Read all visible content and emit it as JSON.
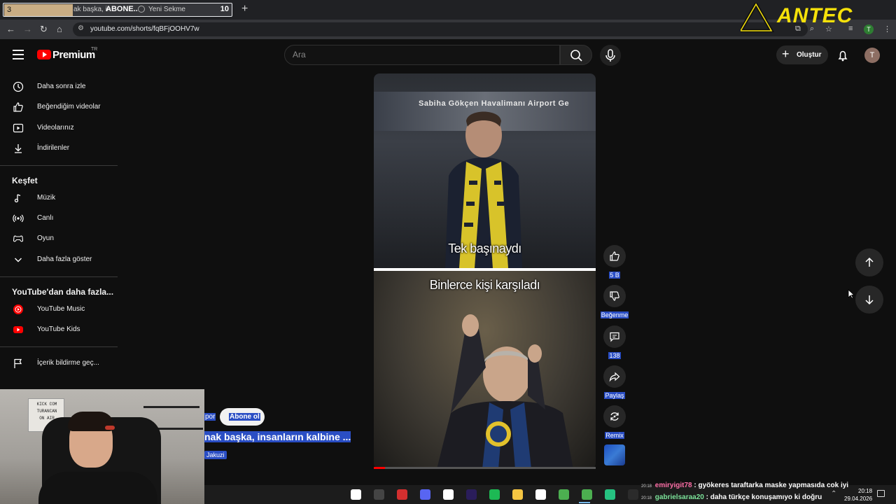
{
  "browser": {
    "tab_number_left": "3",
    "tab_partial_text": "ak başka, in",
    "tab_title": "ABONE..",
    "tab_newtab_label": "Yeni Sekme",
    "tab_count": "10",
    "url": "youtube.com/shorts/fqBFjOOHV7w"
  },
  "overlay_logo": {
    "text": "ANTEC"
  },
  "header": {
    "brand": "Premium",
    "country": "TR",
    "search_placeholder": "Ara",
    "create_label": "Oluştur",
    "avatar_letter": "T"
  },
  "sidebar": {
    "items_top": [
      {
        "label": "Daha sonra izle",
        "icon": "clock-icon"
      },
      {
        "label": "Beğendiğim videolar",
        "icon": "thumb-up-icon"
      },
      {
        "label": "Videolarınız",
        "icon": "play-box-icon"
      },
      {
        "label": "İndirilenler",
        "icon": "download-icon"
      }
    ],
    "explore_title": "Keşfet",
    "explore_items": [
      {
        "label": "Müzik",
        "icon": "music-note-icon"
      },
      {
        "label": "Canlı",
        "icon": "live-icon"
      },
      {
        "label": "Oyun",
        "icon": "gamepad-icon"
      },
      {
        "label": "Daha fazla göster",
        "icon": "chevron-down-icon"
      }
    ],
    "more_title": "YouTube'dan daha fazla...",
    "more_items": [
      {
        "label": "YouTube Music",
        "icon": "youtube-music-icon"
      },
      {
        "label": "YouTube Kids",
        "icon": "youtube-kids-icon"
      }
    ],
    "report_label": "İçerik bildirme geç..."
  },
  "short": {
    "sign_text": "Sabiha Gökçen Havalimanı Airport Ge",
    "caption_top": "Tek başınaydı",
    "caption_bottom": "Binlerce kişi karşıladı",
    "progress": 0.05
  },
  "actions": {
    "likes": "5 B",
    "dislike_label": "Beğenme",
    "comments": "138",
    "share_label": "Paylaş",
    "remix_label": "Remix"
  },
  "overlay_meta": {
    "channel_partial": "por",
    "subscribe_label": "Abone ol",
    "title_partial": "nak başka, insanların kalbine ...",
    "sound_name": "Jakuzi"
  },
  "webcam": {
    "sign_lines": [
      "KICK COM",
      "TURANCAN",
      "ON AIR"
    ]
  },
  "chat": [
    {
      "time": "20:18",
      "user": "emiryigit78",
      "message": ": gyökeres taraftarka maske yapmasıda cok iyi"
    },
    {
      "time": "20:18",
      "user": "gabrielsaraa20",
      "message": ": daha türkçe konuşamıyo ki doğru"
    }
  ],
  "taskbar": {
    "time": "20:18",
    "date": "29.04.2026",
    "apps": [
      {
        "name": "capcut-icon",
        "color": "#ffffff"
      },
      {
        "name": "obs-icon",
        "color": "#444444"
      },
      {
        "name": "red-app-icon",
        "color": "#d32f2f"
      },
      {
        "name": "discord-icon",
        "color": "#5865f2"
      },
      {
        "name": "capcut2-icon",
        "color": "#ffffff"
      },
      {
        "name": "premiere-icon",
        "color": "#2a1d5a"
      },
      {
        "name": "spotify-icon",
        "color": "#1db954"
      },
      {
        "name": "folder-icon",
        "color": "#f4c542"
      },
      {
        "name": "capcut3-icon",
        "color": "#ffffff"
      },
      {
        "name": "chrome-icon",
        "color": "#4caf50"
      },
      {
        "name": "chrome-active-icon",
        "color": "#4caf50"
      },
      {
        "name": "green-app-icon",
        "color": "#26c281"
      },
      {
        "name": "epic-games-icon",
        "color": "#2b2b2b"
      }
    ]
  }
}
